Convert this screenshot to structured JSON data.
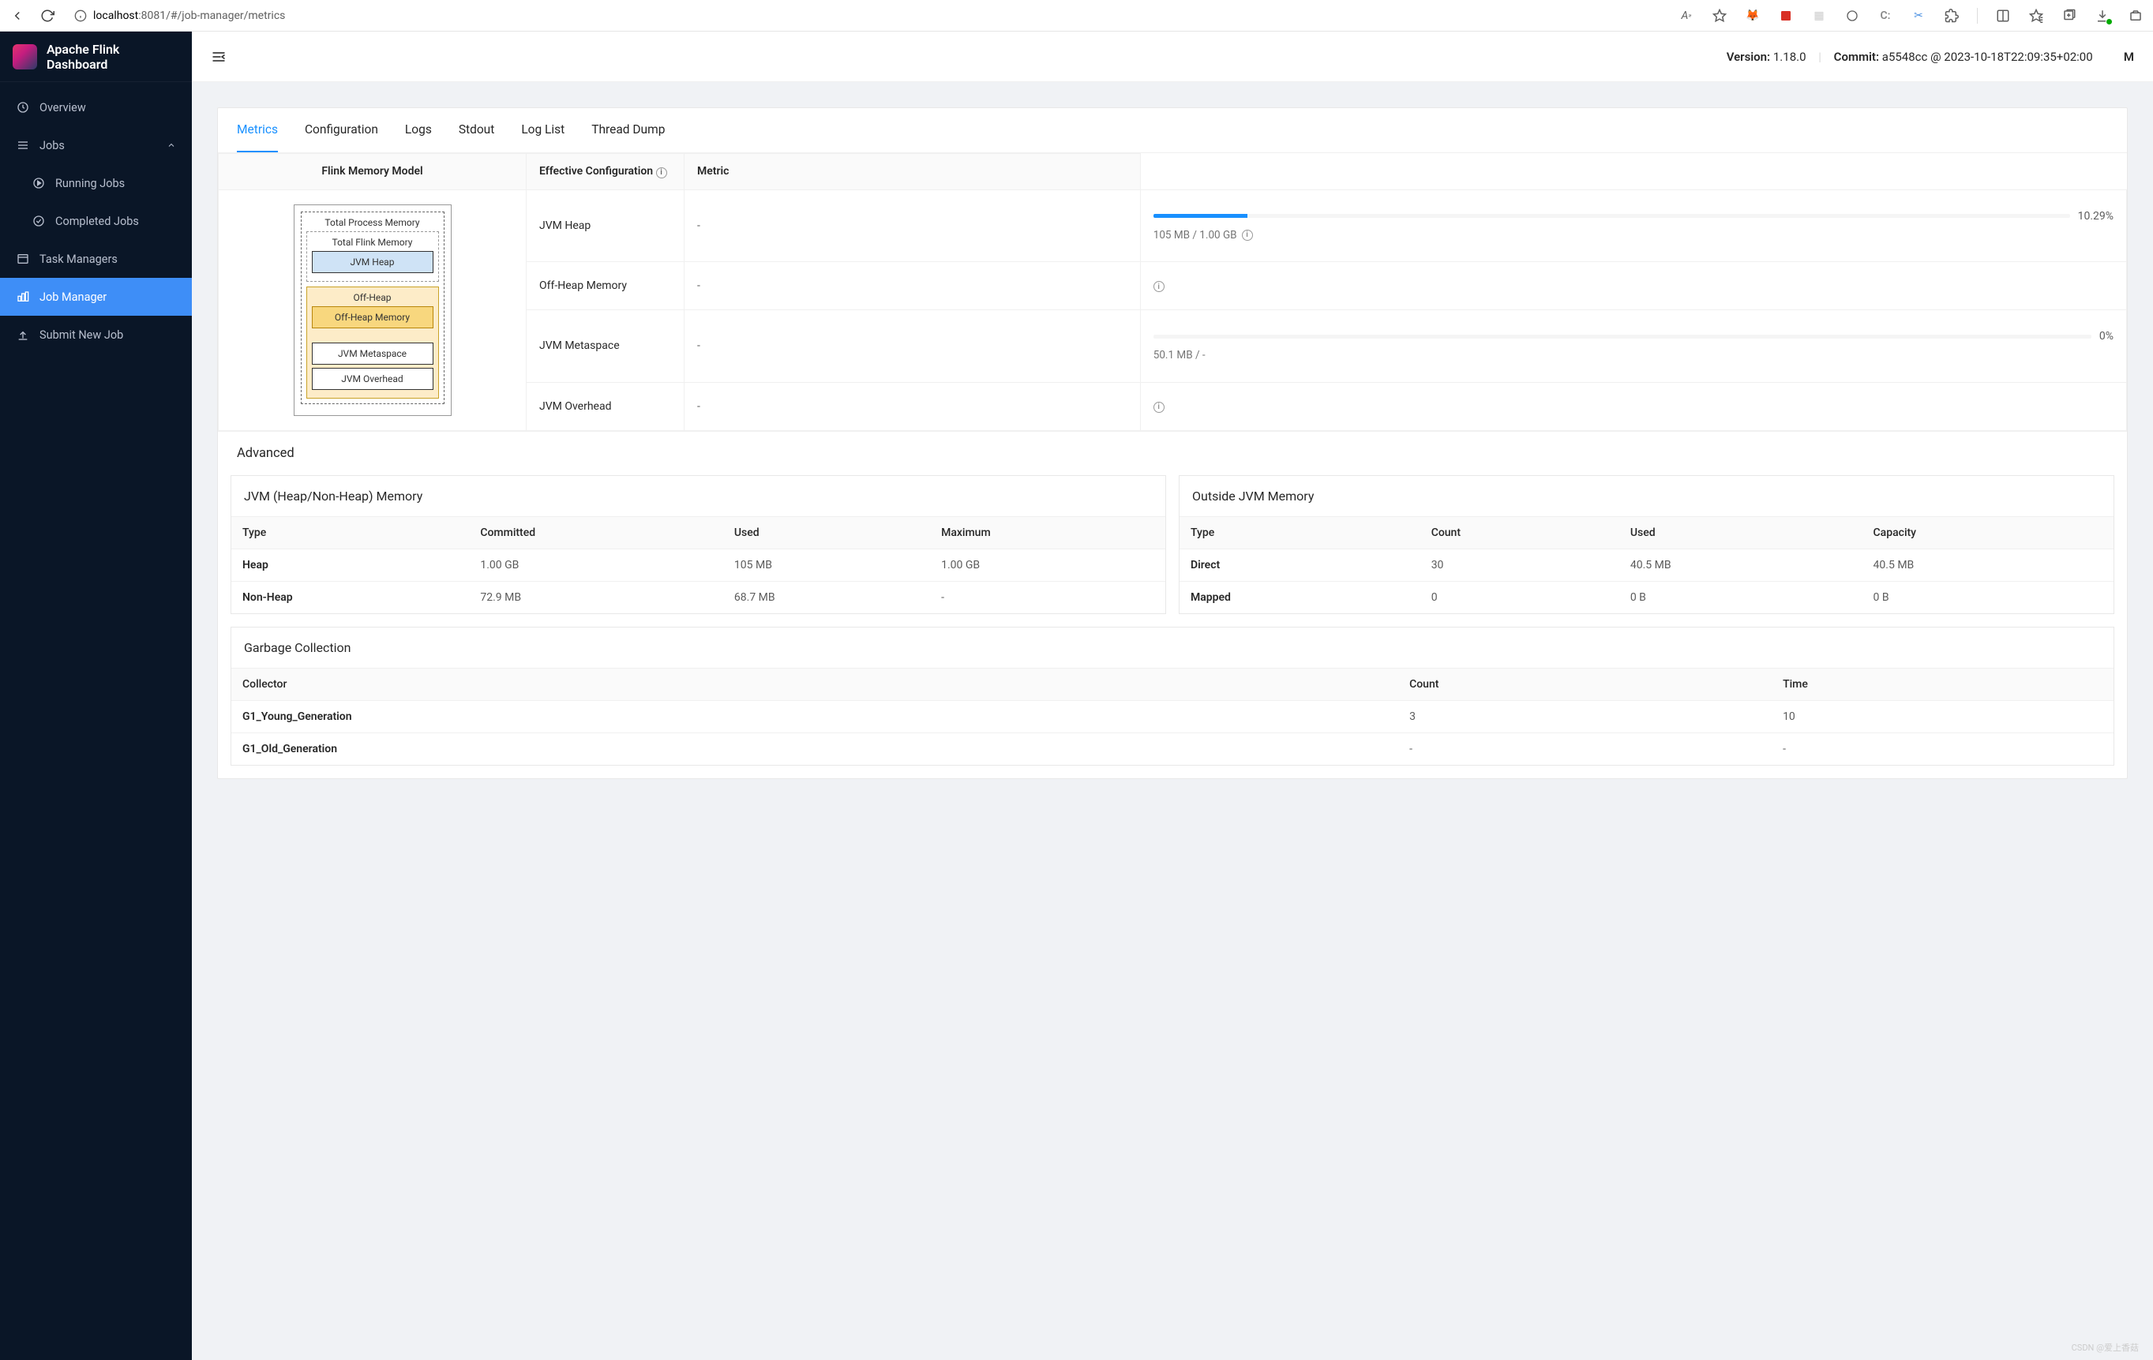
{
  "browser": {
    "url_host": "localhost",
    "url_port_path": ":8081/#/job-manager/metrics"
  },
  "header": {
    "app_title": "Apache Flink Dashboard",
    "version_label": "Version:",
    "version_value": "1.18.0",
    "commit_label": "Commit:",
    "commit_value": "a5548cc @ 2023-10-18T22:09:35+02:00",
    "message_trunc": "M"
  },
  "sidebar": {
    "overview": "Overview",
    "jobs": "Jobs",
    "running_jobs": "Running Jobs",
    "completed_jobs": "Completed Jobs",
    "task_managers": "Task Managers",
    "job_manager": "Job Manager",
    "submit_new_job": "Submit New Job"
  },
  "tabs": {
    "metrics": "Metrics",
    "configuration": "Configuration",
    "logs": "Logs",
    "stdout": "Stdout",
    "log_list": "Log List",
    "thread_dump": "Thread Dump"
  },
  "mem_headers": {
    "model": "Flink Memory Model",
    "effective": "Effective Configuration",
    "metric": "Metric"
  },
  "mem_diagram": {
    "total_process": "Total Process Memory",
    "total_flink": "Total Flink Memory",
    "jvm_heap": "JVM Heap",
    "off_heap": "Off-Heap",
    "off_heap_memory": "Off-Heap Memory",
    "jvm_metaspace": "JVM Metaspace",
    "jvm_overhead": "JVM Overhead"
  },
  "mem_rows": {
    "jvm_heap": {
      "label": "JVM Heap",
      "eff": "-",
      "pct": "10.29%",
      "bar": 10.29,
      "sub": "105 MB / 1.00 GB"
    },
    "off_heap": {
      "label": "Off-Heap Memory",
      "eff": "-"
    },
    "jvm_metaspace": {
      "label": "JVM Metaspace",
      "eff": "-",
      "pct": "0%",
      "bar": 0,
      "sub": "50.1 MB / -"
    },
    "jvm_overhead": {
      "label": "JVM Overhead",
      "eff": "-"
    }
  },
  "advanced": {
    "title": "Advanced",
    "jvm_mem": {
      "title": "JVM (Heap/Non-Heap) Memory",
      "cols": {
        "type": "Type",
        "committed": "Committed",
        "used": "Used",
        "maximum": "Maximum"
      },
      "rows": [
        {
          "type": "Heap",
          "committed": "1.00 GB",
          "used": "105 MB",
          "maximum": "1.00 GB"
        },
        {
          "type": "Non-Heap",
          "committed": "72.9 MB",
          "used": "68.7 MB",
          "maximum": "-"
        }
      ]
    },
    "outside_mem": {
      "title": "Outside JVM Memory",
      "cols": {
        "type": "Type",
        "count": "Count",
        "used": "Used",
        "capacity": "Capacity"
      },
      "rows": [
        {
          "type": "Direct",
          "count": "30",
          "used": "40.5 MB",
          "capacity": "40.5 MB"
        },
        {
          "type": "Mapped",
          "count": "0",
          "used": "0 B",
          "capacity": "0 B"
        }
      ]
    },
    "gc": {
      "title": "Garbage Collection",
      "cols": {
        "collector": "Collector",
        "count": "Count",
        "time": "Time"
      },
      "rows": [
        {
          "collector": "G1_Young_Generation",
          "count": "3",
          "time": "10"
        },
        {
          "collector": "G1_Old_Generation",
          "count": "-",
          "time": "-"
        }
      ]
    }
  },
  "watermark": "CSDN @爱上香菇"
}
